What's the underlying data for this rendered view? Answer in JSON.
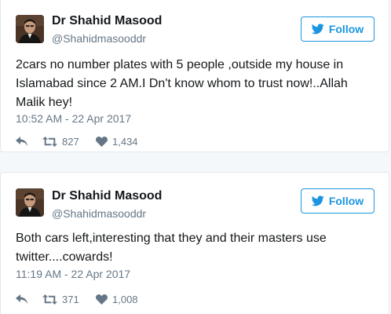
{
  "colors": {
    "accent": "#1b95e0",
    "text": "#14171a",
    "secondary": "#657786",
    "border": "#e1e8ed",
    "background": "#f5f8fa"
  },
  "tweets": [
    {
      "author": {
        "display_name": "Dr Shahid Masood",
        "handle": "@Shahidmasooddr",
        "avatar_icon": "profile-photo"
      },
      "follow_label": "Follow",
      "text": "2cars no number plates with 5 people ,outside my house in Islamabad since 2 AM.I Dn't know whom to trust now!..Allah Malik hey!",
      "timestamp": "10:52 AM - 22 Apr 2017",
      "retweets": "827",
      "likes": "1,434"
    },
    {
      "author": {
        "display_name": "Dr Shahid Masood",
        "handle": "@Shahidmasooddr",
        "avatar_icon": "profile-photo"
      },
      "follow_label": "Follow",
      "text": "Both cars left,interesting that they and their masters use twitter....cowards!",
      "timestamp": "11:19 AM - 22 Apr 2017",
      "retweets": "371",
      "likes": "1,008"
    }
  ]
}
